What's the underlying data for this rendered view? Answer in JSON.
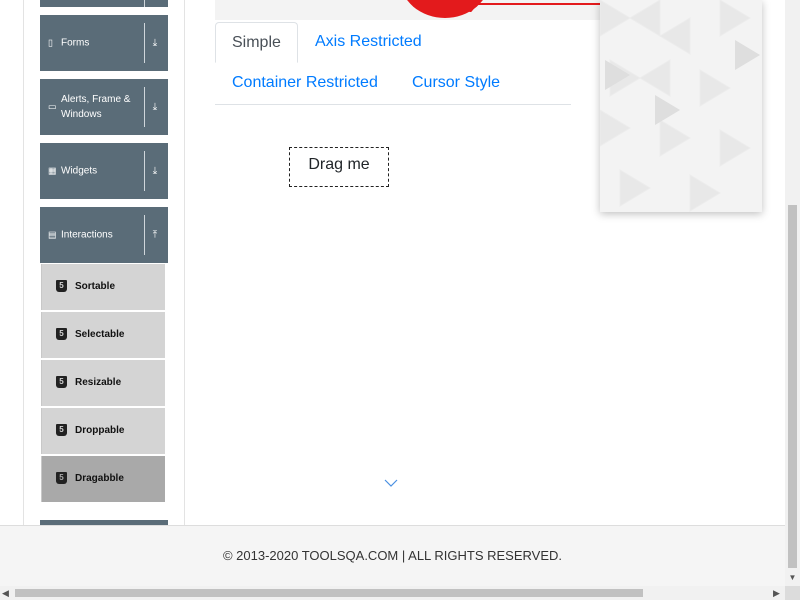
{
  "sidebar": {
    "groups": [
      {
        "label": "Forms",
        "icon": "document-icon"
      },
      {
        "label": "Alerts, Frame & Windows",
        "icon": "window-icon"
      },
      {
        "label": "Widgets",
        "icon": "grid-icon"
      },
      {
        "label": "Interactions",
        "icon": "list-icon",
        "expanded": true
      }
    ],
    "items": [
      {
        "label": "Sortable"
      },
      {
        "label": "Selectable"
      },
      {
        "label": "Resizable"
      },
      {
        "label": "Droppable"
      },
      {
        "label": "Dragabble",
        "active": true
      }
    ],
    "item_badge": "5"
  },
  "tabs": {
    "simple": "Simple",
    "axis": "Axis Restricted",
    "container": "Container Restricted",
    "cursor": "Cursor Style",
    "active": "Simple"
  },
  "drag_box": {
    "label": "Drag me"
  },
  "footer": {
    "copyright": "© 2013-2020 TOOLSQA.COM | ALL RIGHTS RESERVED."
  },
  "colors": {
    "sidebar_header": "#5a6c78",
    "menu_item": "#d4d4d4",
    "menu_item_active": "#a9a9a9",
    "link": "#007bff",
    "banner_red": "#e31a1c"
  }
}
